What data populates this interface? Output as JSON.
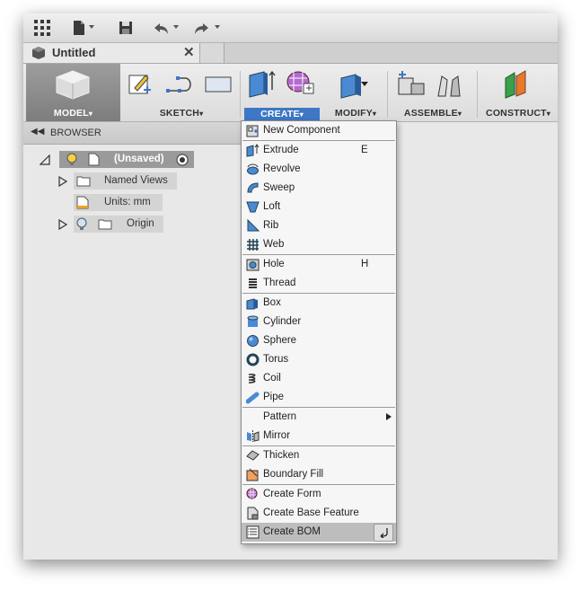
{
  "window": {
    "doc_tab_title": "Untitled",
    "close_glyph": "✕"
  },
  "toolbar": {
    "groups": [
      {
        "label": "MODEL",
        "icon": "model-cube-icon"
      },
      {
        "label": "SKETCH",
        "icon": "sketch-icon"
      },
      {
        "label": "CREATE",
        "icon": "create-box-icon"
      },
      {
        "label": "MODIFY",
        "icon": "modify-icon"
      },
      {
        "label": "ASSEMBLE",
        "icon": "assemble-icon"
      },
      {
        "label": "CONSTRUCT",
        "icon": "construct-plane-icon"
      }
    ],
    "dropdown_glyph": "▾"
  },
  "browser": {
    "title": "BROWSER",
    "root": "(Unsaved)",
    "items": [
      {
        "label": "Named Views"
      },
      {
        "label": "Units: mm"
      },
      {
        "label": "Origin"
      }
    ]
  },
  "menu": {
    "items": [
      {
        "label": "New Component",
        "shortcut": "",
        "icon": "new-component-icon"
      },
      {
        "label": "Extrude",
        "shortcut": "E",
        "icon": "extrude-icon"
      },
      {
        "label": "Revolve",
        "shortcut": "",
        "icon": "revolve-icon"
      },
      {
        "label": "Sweep",
        "shortcut": "",
        "icon": "sweep-icon"
      },
      {
        "label": "Loft",
        "shortcut": "",
        "icon": "loft-icon"
      },
      {
        "label": "Rib",
        "shortcut": "",
        "icon": "rib-icon"
      },
      {
        "label": "Web",
        "shortcut": "",
        "icon": "web-icon"
      },
      {
        "label": "Hole",
        "shortcut": "H",
        "icon": "hole-icon"
      },
      {
        "label": "Thread",
        "shortcut": "",
        "icon": "thread-icon"
      },
      {
        "label": "Box",
        "shortcut": "",
        "icon": "box-icon"
      },
      {
        "label": "Cylinder",
        "shortcut": "",
        "icon": "cylinder-icon"
      },
      {
        "label": "Sphere",
        "shortcut": "",
        "icon": "sphere-icon"
      },
      {
        "label": "Torus",
        "shortcut": "",
        "icon": "torus-icon"
      },
      {
        "label": "Coil",
        "shortcut": "",
        "icon": "coil-icon"
      },
      {
        "label": "Pipe",
        "shortcut": "",
        "icon": "pipe-icon"
      },
      {
        "label": "Pattern",
        "shortcut": "",
        "icon": ""
      },
      {
        "label": "Mirror",
        "shortcut": "",
        "icon": "mirror-icon"
      },
      {
        "label": "Thicken",
        "shortcut": "",
        "icon": "thicken-icon"
      },
      {
        "label": "Boundary Fill",
        "shortcut": "",
        "icon": "boundary-fill-icon"
      },
      {
        "label": "Create Form",
        "shortcut": "",
        "icon": "create-form-icon"
      },
      {
        "label": "Create Base Feature",
        "shortcut": "",
        "icon": "base-feature-icon"
      },
      {
        "label": "Create BOM",
        "shortcut": "",
        "icon": "bom-icon"
      }
    ]
  },
  "colors": {
    "accent": "#3d77c5",
    "window_bg": "#e8e8e8",
    "menu_bg": "#f6f6f6",
    "highlight": "#bdbdbd"
  }
}
